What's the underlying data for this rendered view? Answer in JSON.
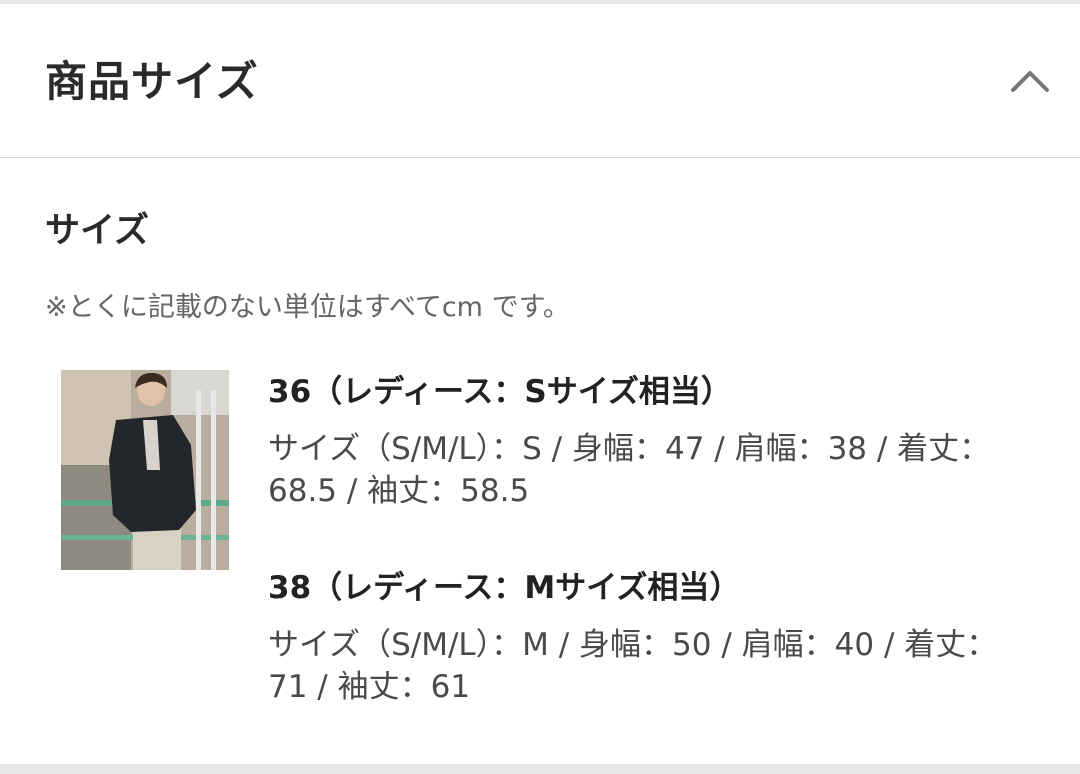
{
  "header": {
    "title": "商品サイズ",
    "toggle_icon": "chevron-up-icon"
  },
  "section": {
    "title": "サイズ",
    "note": "※とくに記載のない単位はすべてcm です。"
  },
  "sizes": [
    {
      "heading": "36（レディース：Sサイズ相当）",
      "detail": "サイズ（S/M/L）：S / 身幅：47 / 肩幅：38 / 着丈：68.5 / 袖丈：58.5"
    },
    {
      "heading": "38（レディース：Mサイズ相当）",
      "detail": "サイズ（S/M/L）：M / 身幅：50 / 肩幅：40 / 着丈：71 / 袖丈：61"
    }
  ],
  "colors": {
    "text_primary": "#222222",
    "text_secondary": "#4a4a4a",
    "note_gray": "#666666",
    "divider": "#d6d6d6"
  }
}
